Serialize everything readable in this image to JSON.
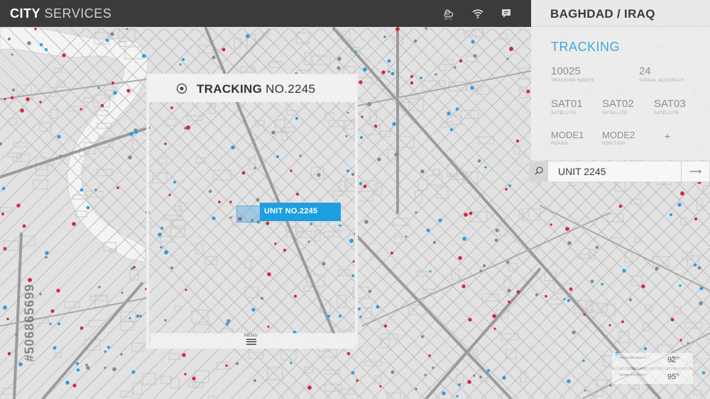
{
  "app": {
    "brand_bold": "CITY",
    "brand_light": "SERVICES"
  },
  "topbar": {
    "icons": [
      "weather-icon",
      "wifi-icon",
      "chat-icon"
    ],
    "weather_temp": "20°C"
  },
  "panel": {
    "location": "BAGHDAD / IRAQ",
    "section_title": "TRACKING",
    "stats": [
      {
        "value": "10025",
        "label": "TRACKING NODES"
      },
      {
        "value": "24",
        "label": "SIGNAL ACCURACY"
      },
      {
        "value": "SAT01",
        "label": "SATELLITE"
      },
      {
        "value": "SAT02",
        "label": "SATELLITE"
      },
      {
        "value": "SAT03",
        "label": "SATELLITE"
      },
      {
        "value": "MODE1",
        "label": "ROADS"
      },
      {
        "value": "MODE2",
        "label": "POSITION"
      }
    ],
    "add_symbol": "+"
  },
  "search": {
    "value": "UNIT 2245",
    "go_symbol": "⟶"
  },
  "card": {
    "title_bold": "TRACKING",
    "title_light": "NO.2245",
    "menu_label": "MENU"
  },
  "unit": {
    "label": "UNIT NO.2245"
  },
  "watermark": {
    "id": "#506865699"
  },
  "metrics": [
    {
      "label": "TRACK RELIABILITY",
      "value": "92",
      "unit": "%"
    },
    {
      "label": "SIGNAL ACCURACY",
      "value": "95",
      "unit": "%"
    }
  ],
  "colors": {
    "accent": "#1e9fe0",
    "marker_red": "#d02b3c",
    "marker_blue": "#2f9fdc",
    "topbar": "#3b3b3b"
  }
}
